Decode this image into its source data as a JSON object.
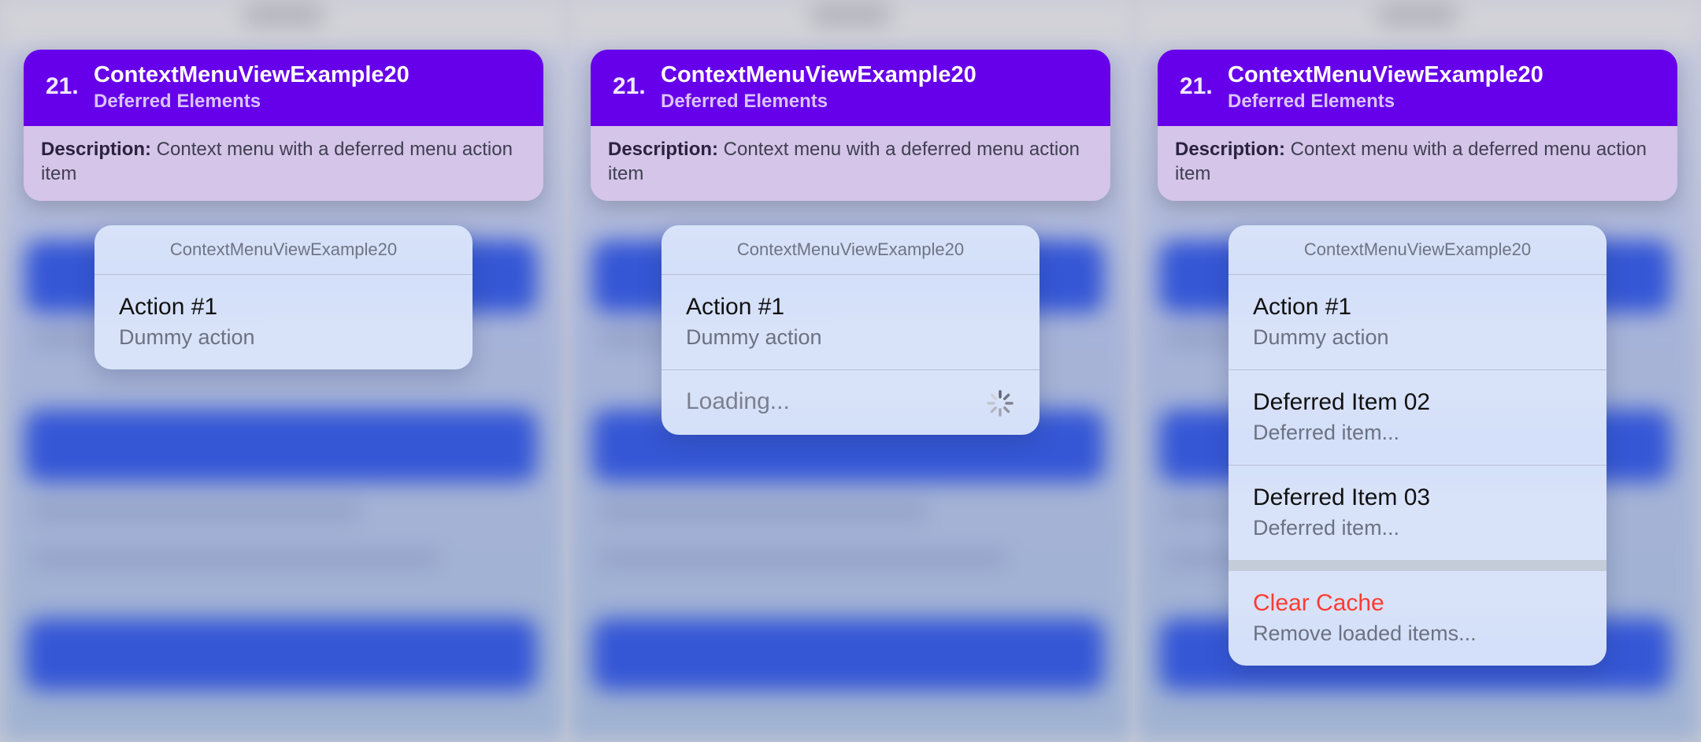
{
  "panels": [
    {
      "header": {
        "number": "21.",
        "title": "ContextMenuViewExample20",
        "subtitle": "Deferred Elements",
        "description_label": "Description:",
        "description_text": " Context menu with a deferred menu action item"
      },
      "menu": {
        "title": "ContextMenuViewExample20",
        "items": [
          {
            "title": "Action #1",
            "subtitle": "Dummy action"
          }
        ]
      }
    },
    {
      "header": {
        "number": "21.",
        "title": "ContextMenuViewExample20",
        "subtitle": "Deferred Elements",
        "description_label": "Description:",
        "description_text": " Context menu with a deferred menu action item"
      },
      "menu": {
        "title": "ContextMenuViewExample20",
        "items": [
          {
            "title": "Action #1",
            "subtitle": "Dummy action"
          }
        ],
        "loading_label": "Loading..."
      }
    },
    {
      "header": {
        "number": "21.",
        "title": "ContextMenuViewExample20",
        "subtitle": "Deferred Elements",
        "description_label": "Description:",
        "description_text": " Context menu with a deferred menu action item"
      },
      "menu": {
        "title": "ContextMenuViewExample20",
        "items": [
          {
            "title": "Action #1",
            "subtitle": "Dummy action"
          },
          {
            "title": "Deferred Item 02",
            "subtitle": "Deferred item..."
          },
          {
            "title": "Deferred Item 03",
            "subtitle": "Deferred item..."
          }
        ],
        "destructive": {
          "title": "Clear Cache",
          "subtitle": "Remove loaded items..."
        }
      }
    }
  ],
  "colors": {
    "header_bg": "#6700ea",
    "description_bg": "#d5c5e8",
    "destructive": "#ff3b30",
    "menu_bg": "#dae4fa"
  },
  "icons": {
    "loading": "activity-spinner-icon"
  }
}
